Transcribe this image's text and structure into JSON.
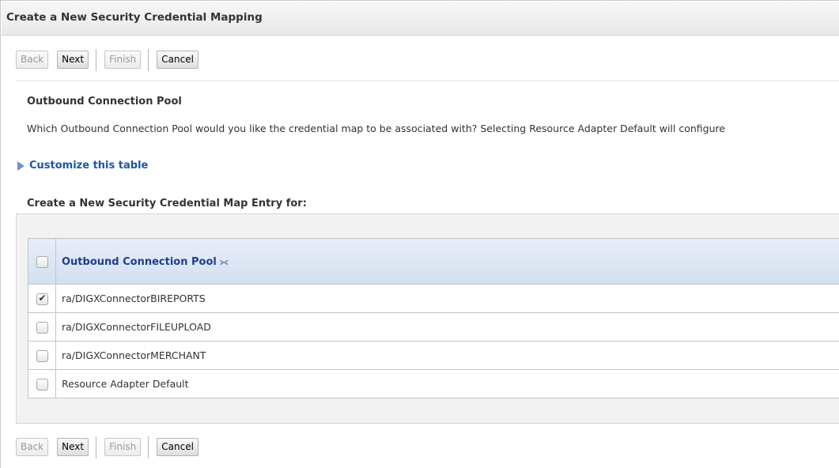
{
  "window": {
    "title": "Create a New Security Credential Mapping"
  },
  "toolbar_top": {
    "back": "Back",
    "next": "Next",
    "finish": "Finish",
    "cancel": "Cancel"
  },
  "section": {
    "heading": "Outbound Connection Pool",
    "description": "Which Outbound Connection Pool would you like the credential map to be associated with? Selecting Resource Adapter Default will configure"
  },
  "customize_link": "Customize this table",
  "table": {
    "caption": "Create a New Security Credential Map Entry for:",
    "header": "Outbound Connection Pool",
    "rows": [
      {
        "label": "ra/DIGXConnectorBIREPORTS",
        "checked": true
      },
      {
        "label": "ra/DIGXConnectorFILEUPLOAD",
        "checked": false
      },
      {
        "label": "ra/DIGXConnectorMERCHANT",
        "checked": false
      },
      {
        "label": "Resource Adapter Default",
        "checked": false
      }
    ]
  },
  "toolbar_bottom": {
    "back": "Back",
    "next": "Next",
    "finish": "Finish",
    "cancel": "Cancel"
  },
  "icons": {
    "sort": "sort-ascending-icon",
    "expand": "triangle-right-icon"
  }
}
